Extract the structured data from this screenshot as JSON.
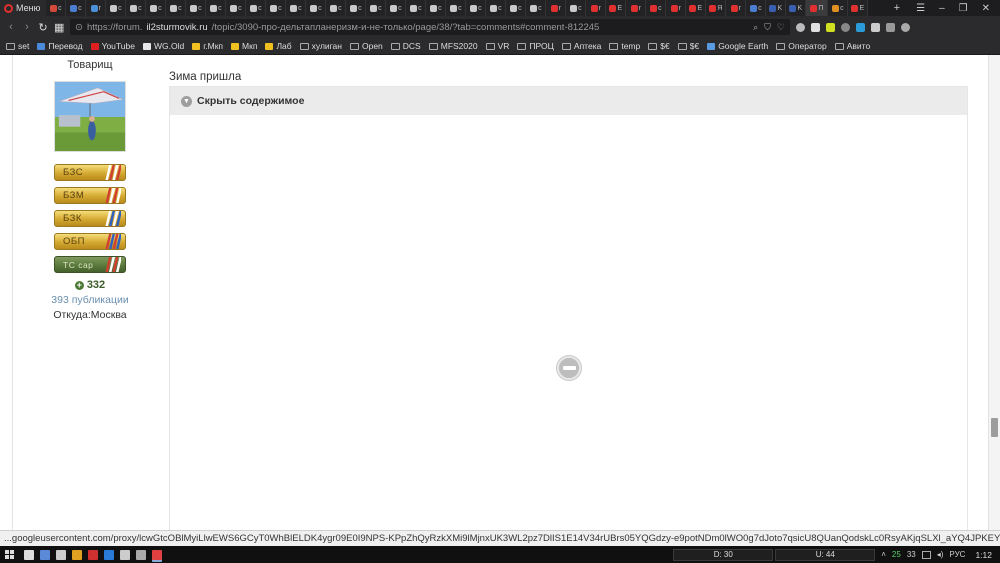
{
  "browser": {
    "menu_label": "Меню",
    "tabs": [
      {
        "t": "c",
        "color": "#d34a3a"
      },
      {
        "t": "c",
        "color": "#4a7ed0"
      },
      {
        "t": "r",
        "color": "#4a90d9"
      },
      {
        "t": "c",
        "color": "#c9c9c9"
      },
      {
        "t": "c",
        "color": "#c9c9c9"
      },
      {
        "t": "c",
        "color": "#c9c9c9"
      },
      {
        "t": "c",
        "color": "#c9c9c9"
      },
      {
        "t": "c",
        "color": "#c9c9c9"
      },
      {
        "t": "c",
        "color": "#c9c9c9"
      },
      {
        "t": "c",
        "color": "#c9c9c9"
      },
      {
        "t": "c",
        "color": "#c9c9c9"
      },
      {
        "t": "c",
        "color": "#c9c9c9"
      },
      {
        "t": "c",
        "color": "#c9c9c9"
      },
      {
        "t": "c",
        "color": "#c9c9c9"
      },
      {
        "t": "c",
        "color": "#c9c9c9"
      },
      {
        "t": "c",
        "color": "#c9c9c9"
      },
      {
        "t": "c",
        "color": "#c9c9c9"
      },
      {
        "t": "c",
        "color": "#c9c9c9"
      },
      {
        "t": "c",
        "color": "#c9c9c9"
      },
      {
        "t": "c",
        "color": "#c9c9c9"
      },
      {
        "t": "c",
        "color": "#c9c9c9"
      },
      {
        "t": "c",
        "color": "#c9c9c9"
      },
      {
        "t": "c",
        "color": "#c9c9c9"
      },
      {
        "t": "c",
        "color": "#c9c9c9"
      },
      {
        "t": "c",
        "color": "#c9c9c9"
      },
      {
        "t": "r",
        "color": "#e03030"
      },
      {
        "t": "c",
        "color": "#c9c9c9"
      },
      {
        "t": "r",
        "color": "#e03030"
      },
      {
        "t": "E",
        "color": "#e03030"
      },
      {
        "t": "r",
        "color": "#e03030"
      },
      {
        "t": "c",
        "color": "#e03030"
      },
      {
        "t": "r",
        "color": "#e03030"
      },
      {
        "t": "E",
        "color": "#e03030"
      },
      {
        "t": "Я",
        "color": "#e03030"
      },
      {
        "t": "r",
        "color": "#e03030"
      },
      {
        "t": "c",
        "color": "#4a7ed0"
      },
      {
        "t": "K",
        "color": "#3a5fb0"
      },
      {
        "t": "K",
        "color": "#3a5fb0"
      },
      {
        "t": "П",
        "color": "#e03030",
        "active": true
      },
      {
        "t": "c",
        "color": "#e09020"
      },
      {
        "t": "E",
        "color": "#e03030"
      }
    ],
    "url_prefix": "https://forum.",
    "url_host": "il2sturmovik.ru",
    "url_path": "/topic/3090-про-дельтапланеризм-и-не-только/page/38/?tab=comments#comment-812245",
    "bookmarks": [
      {
        "label": "set",
        "type": "folder"
      },
      {
        "label": "Перевод",
        "type": "icon",
        "color": "#4a8ad8"
      },
      {
        "label": "YouTube",
        "type": "icon",
        "color": "#e02020"
      },
      {
        "label": "WG.Old",
        "type": "icon",
        "color": "#e8e8e8"
      },
      {
        "label": "г.Мкп",
        "type": "icon",
        "color": "#f0c020"
      },
      {
        "label": "Мкп",
        "type": "icon",
        "color": "#f0c020"
      },
      {
        "label": "Лаб",
        "type": "icon",
        "color": "#f0c020"
      },
      {
        "label": "хулиган",
        "type": "folder"
      },
      {
        "label": "Open",
        "type": "folder"
      },
      {
        "label": "DCS",
        "type": "folder"
      },
      {
        "label": "MFS2020",
        "type": "folder"
      },
      {
        "label": "VR",
        "type": "folder"
      },
      {
        "label": "ПРОЦ",
        "type": "folder"
      },
      {
        "label": "Аптека",
        "type": "folder"
      },
      {
        "label": "temp",
        "type": "folder"
      },
      {
        "label": "$€",
        "type": "folder"
      },
      {
        "label": "$€",
        "type": "folder"
      },
      {
        "label": "Google Earth",
        "type": "icon",
        "color": "#5a9ae0"
      },
      {
        "label": "Оператор",
        "type": "folder"
      },
      {
        "label": "Авито",
        "type": "folder"
      }
    ]
  },
  "author": {
    "title": "Товарищ",
    "badges": [
      {
        "label": "БЗС",
        "style": "gold"
      },
      {
        "label": "БЗМ",
        "style": "gold"
      },
      {
        "label": "БЗК",
        "style": "gold"
      },
      {
        "label": "ОБП",
        "style": "gold"
      },
      {
        "label": "ТС сар",
        "style": "dark"
      }
    ],
    "reputation": "332",
    "posts": "393 публикации",
    "location": "Откуда:Москва"
  },
  "post": {
    "text": "Зима пришла",
    "spoiler_label": "Скрыть содержимое"
  },
  "status_url": "...googleusercontent.com/proxy/lcwGtcOBlMyiLlwEWS6GCyT0WhBlELDK4ygr09E0I9NPS-KPpZhQyRzkXMi9lMjnxUK3WL2pz7DlIS1E14V34rUBrs05YQGdzy-e9potNDm0lWO0g7dJoto7qsicU8QUanQodskLc0RsyAKjqSLXl_aYQ4JPKEYsxw5VuV3vbJmkWlgrHeHeojZ7...",
  "taskbar": {
    "icons": [
      "#ddd",
      "#5a8ad8",
      "#ccc",
      "#e0a020",
      "#d03030",
      "#2a7ad8",
      "#ccc",
      "#aaa",
      "#e04040"
    ],
    "monitor_1": "D: 30",
    "monitor_2": "U: 44",
    "tray_num_1": "25",
    "tray_num_2": "33",
    "lang": "РУС",
    "time": "1:12"
  }
}
